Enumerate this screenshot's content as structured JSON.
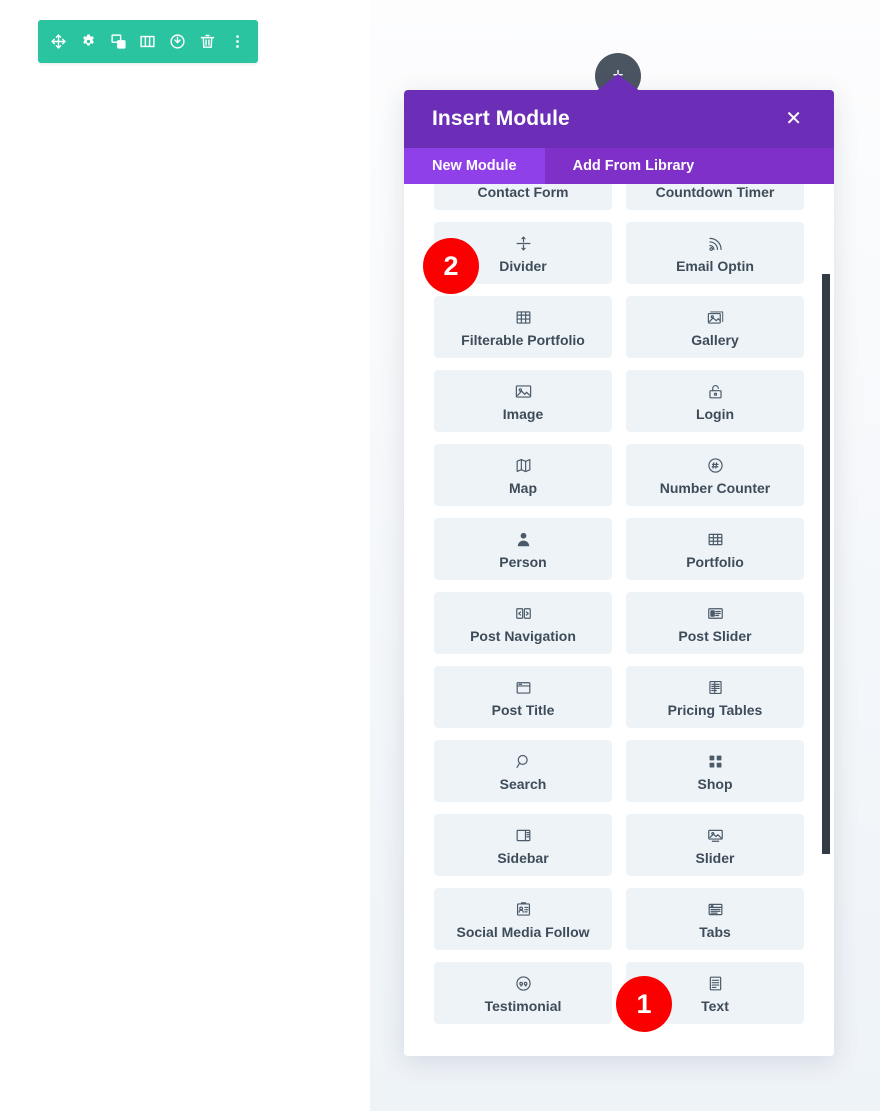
{
  "toolbar": {
    "name": "module-settings-toolbar",
    "color": "#2bc4a0",
    "buttons": [
      {
        "name": "move-icon",
        "title": "Move Module"
      },
      {
        "name": "gear-icon",
        "title": "Module Settings"
      },
      {
        "name": "duplicate-icon",
        "title": "Duplicate Module"
      },
      {
        "name": "columns-icon",
        "title": "Change Column Structure"
      },
      {
        "name": "power-icon",
        "title": "Disable Module"
      },
      {
        "name": "trash-icon",
        "title": "Delete Module"
      },
      {
        "name": "more-options-icon",
        "title": "More Options"
      }
    ]
  },
  "add_button": {
    "name": "add-module-button",
    "glyph": "+",
    "color": "#4b5562"
  },
  "modal": {
    "title": "Insert Module",
    "close_label": "✕",
    "header_color": "#6c2eb7",
    "tabs": [
      {
        "label": "New Module",
        "active": true
      },
      {
        "label": "Add From Library",
        "active": false
      }
    ],
    "modules": [
      {
        "label": "Contact Form",
        "icon": "contact-form-icon",
        "clipped": true
      },
      {
        "label": "Countdown Timer",
        "icon": "countdown-timer-icon",
        "clipped": true
      },
      {
        "label": "Divider",
        "icon": "divider-icon"
      },
      {
        "label": "Email Optin",
        "icon": "email-optin-icon"
      },
      {
        "label": "Filterable Portfolio",
        "icon": "filterable-portfolio-icon"
      },
      {
        "label": "Gallery",
        "icon": "gallery-icon"
      },
      {
        "label": "Image",
        "icon": "image-icon"
      },
      {
        "label": "Login",
        "icon": "login-icon"
      },
      {
        "label": "Map",
        "icon": "map-icon"
      },
      {
        "label": "Number Counter",
        "icon": "number-counter-icon"
      },
      {
        "label": "Person",
        "icon": "person-icon"
      },
      {
        "label": "Portfolio",
        "icon": "portfolio-icon"
      },
      {
        "label": "Post Navigation",
        "icon": "post-navigation-icon"
      },
      {
        "label": "Post Slider",
        "icon": "post-slider-icon"
      },
      {
        "label": "Post Title",
        "icon": "post-title-icon"
      },
      {
        "label": "Pricing Tables",
        "icon": "pricing-tables-icon"
      },
      {
        "label": "Search",
        "icon": "search-icon"
      },
      {
        "label": "Shop",
        "icon": "shop-icon"
      },
      {
        "label": "Sidebar",
        "icon": "sidebar-icon"
      },
      {
        "label": "Slider",
        "icon": "slider-icon"
      },
      {
        "label": "Social Media Follow",
        "icon": "social-media-follow-icon"
      },
      {
        "label": "Tabs",
        "icon": "tabs-icon"
      },
      {
        "label": "Testimonial",
        "icon": "testimonial-icon"
      },
      {
        "label": "Text",
        "icon": "text-icon"
      }
    ]
  },
  "annotations": {
    "color": "#fb0000",
    "badges": [
      {
        "id": "step-badge-1",
        "number": "1",
        "target": "Text"
      },
      {
        "id": "step-badge-2",
        "number": "2",
        "target": "Divider"
      }
    ]
  },
  "scrollbar": {
    "name": "modal-scrollbar",
    "color": "#333c46"
  }
}
